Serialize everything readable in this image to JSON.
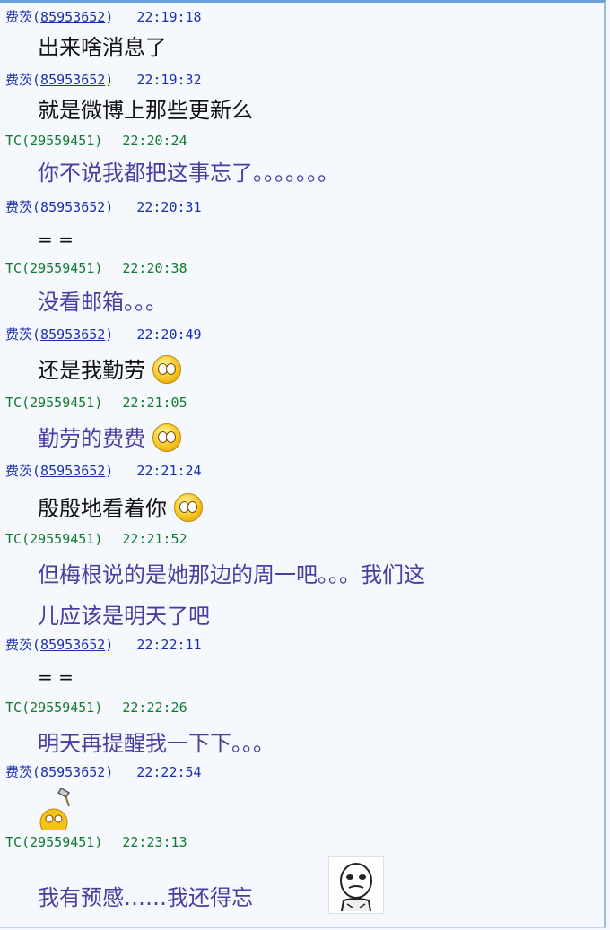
{
  "messages": [
    {
      "sender": "费茨",
      "qq": "85953652",
      "time": "22:19:18",
      "text": "出来啥消息了"
    },
    {
      "sender": "费茨",
      "qq": "85953652",
      "time": "22:19:32",
      "text": "就是微博上那些更新么"
    },
    {
      "sender": "TC",
      "qq": "29559451",
      "time": "22:20:24",
      "text": "你不说我都把这事忘了。。。。。。。"
    },
    {
      "sender": "费茨",
      "qq": "85953652",
      "time": "22:20:31",
      "text": "= ="
    },
    {
      "sender": "TC",
      "qq": "29559451",
      "time": "22:20:38",
      "text": "没看邮箱。。。"
    },
    {
      "sender": "费茨",
      "qq": "85953652",
      "time": "22:20:49",
      "text": "还是我勤劳"
    },
    {
      "sender": "TC",
      "qq": "29559451",
      "time": "22:21:05",
      "text": "勤劳的费费"
    },
    {
      "sender": "费茨",
      "qq": "85953652",
      "time": "22:21:24",
      "text": "殷殷地看着你"
    },
    {
      "sender": "TC",
      "qq": "29559451",
      "time": "22:21:52",
      "text_line1": "但梅根说的是她那边的周一吧。。。我们这",
      "text_line2": "儿应该是明天了吧"
    },
    {
      "sender": "费茨",
      "qq": "85953652",
      "time": "22:22:11",
      "text": "= ="
    },
    {
      "sender": "TC",
      "qq": "29559451",
      "time": "22:22:26",
      "text": "明天再提醒我一下下。。。"
    },
    {
      "sender": "费茨",
      "qq": "85953652",
      "time": "22:22:54",
      "text": ""
    },
    {
      "sender": "TC",
      "qq": "29559451",
      "time": "22:23:13",
      "text": "我有预感……我还得忘"
    }
  ],
  "icons": {
    "emoticon": "flushed-face-emoji-icon",
    "hammer_emoticon": "hammer-smash-emoji-icon",
    "meme": "meme-face-sticker-icon"
  },
  "colors": {
    "self_header": "#1a2fae",
    "peer_header": "#117a2f",
    "self_text": "#111111",
    "peer_text": "#4a3da0",
    "background": "#f5f8fd"
  }
}
